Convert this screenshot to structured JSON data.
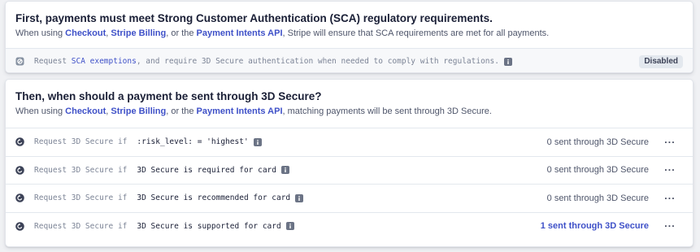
{
  "sca": {
    "title": "First, payments must meet Strong Customer Authentication (SCA) regulatory requirements.",
    "sub_prefix": "When using ",
    "link_checkout": "Checkout",
    "sep1": ", ",
    "link_billing": "Stripe Billing",
    "sep2": ", or the ",
    "link_intents": "Payment Intents API",
    "sub_suffix": ", Stripe will ensure that SCA requirements are met for all payments.",
    "exemption": {
      "prefix": "Request ",
      "link": "SCA exemptions",
      "suffix": ", and require 3D Secure authentication when needed to comply with regulations.",
      "badge": "Disabled"
    }
  },
  "three_ds": {
    "title": "Then, when should a payment be sent through 3D Secure?",
    "sub_prefix": "When using ",
    "link_checkout": "Checkout",
    "sep1": ", ",
    "link_billing": "Stripe Billing",
    "sep2": ", or the ",
    "link_intents": "Payment Intents API",
    "sub_suffix": ", matching payments will be sent through 3D Secure.",
    "rules": [
      {
        "prefix": "Request 3D Secure if",
        "condition": ":risk_level: = 'highest'",
        "count": "0 sent through 3D Secure"
      },
      {
        "prefix": "Request 3D Secure if",
        "condition": "3D Secure is required for card",
        "count": "0 sent through 3D Secure"
      },
      {
        "prefix": "Request 3D Secure if",
        "condition": "3D Secure is recommended for card",
        "count": "0 sent through 3D Secure"
      },
      {
        "prefix": "Request 3D Secure if",
        "condition": "3D Secure is supported for card",
        "count": "1 sent through 3D Secure"
      }
    ],
    "more_label": "···"
  },
  "colors": {
    "link": "#3f51c8",
    "text": "#1a1f36",
    "muted": "#7c8496",
    "badge_bg": "#e3e8ee"
  },
  "icons": {
    "exemption": "shield-exemption-icon",
    "rule": "redirect-arrow-icon",
    "info": "info-icon",
    "more": "more-dots-icon"
  }
}
